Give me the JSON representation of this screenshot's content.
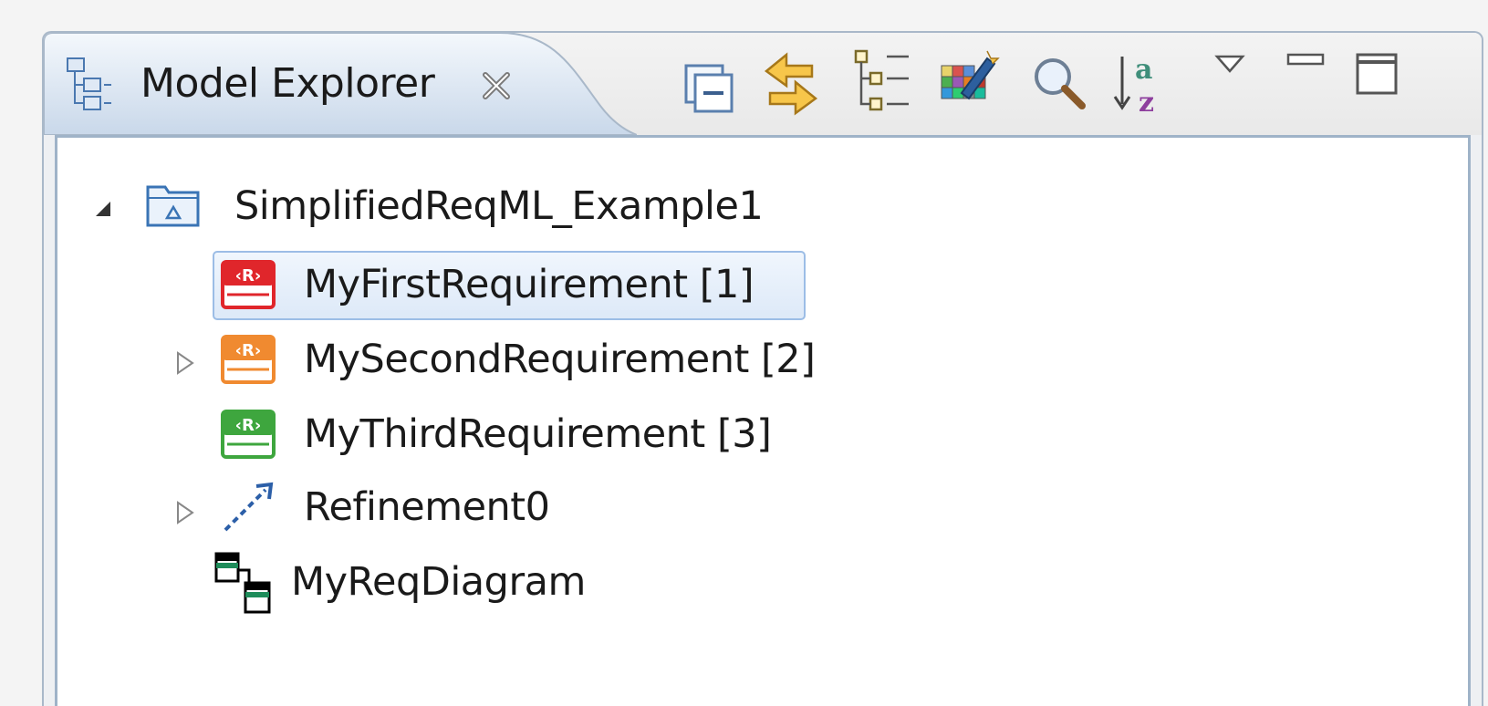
{
  "view": {
    "title": "Model Explorer",
    "toolbar": [
      {
        "name": "collapse-all-icon"
      },
      {
        "name": "link-with-editor-icon"
      },
      {
        "name": "tree-structure-icon"
      },
      {
        "name": "customize-icon"
      },
      {
        "name": "search-icon"
      },
      {
        "name": "sort-alphabetical-icon"
      },
      {
        "name": "view-menu-icon"
      },
      {
        "name": "minimize-icon"
      },
      {
        "name": "maximize-icon"
      }
    ]
  },
  "tree": {
    "root": {
      "label": "SimplifiedReqML_Example1",
      "icon": "model-folder-icon",
      "expanded": true
    },
    "children": [
      {
        "label": "MyFirstRequirement [1]",
        "icon": "requirement-icon",
        "color": "#e0262b",
        "selected": true,
        "expandable": false
      },
      {
        "label": "MySecondRequirement [2]",
        "icon": "requirement-icon",
        "color": "#f08a30",
        "selected": false,
        "expandable": true
      },
      {
        "label": "MyThirdRequirement [3]",
        "icon": "requirement-icon",
        "color": "#3ea63e",
        "selected": false,
        "expandable": false
      },
      {
        "label": "Refinement0",
        "icon": "refinement-arrow-icon",
        "color": "#2c5fa8",
        "selected": false,
        "expandable": true
      },
      {
        "label": "MyReqDiagram",
        "icon": "diagram-icon",
        "selected": false,
        "expandable": false
      }
    ]
  }
}
